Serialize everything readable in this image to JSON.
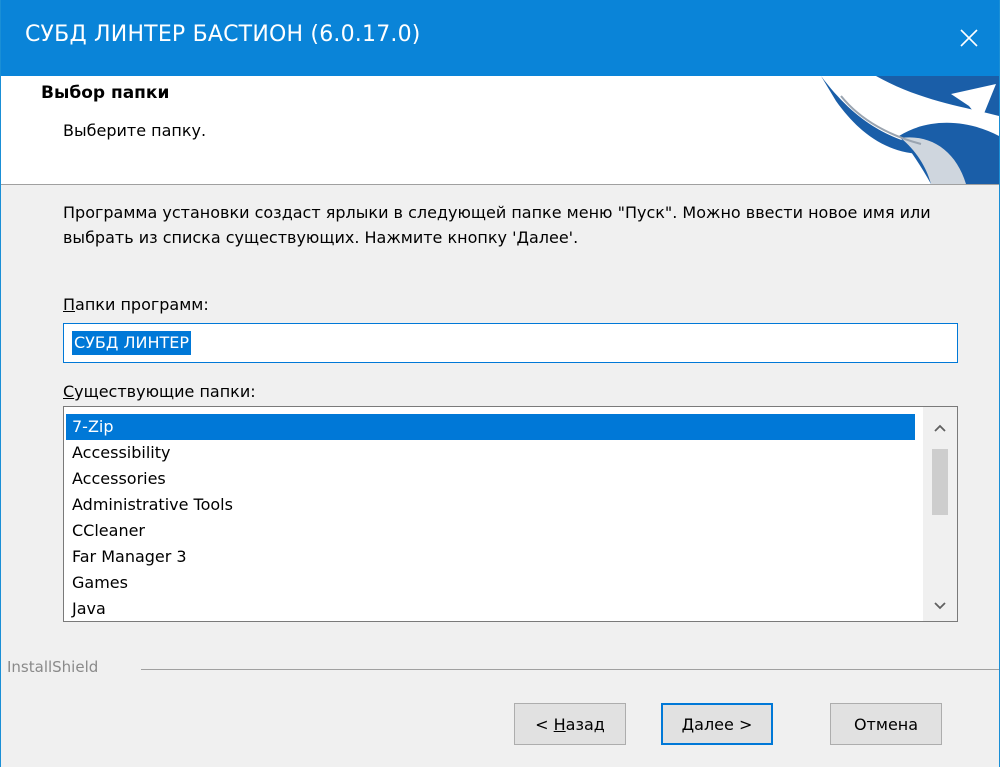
{
  "window": {
    "title": "СУБД ЛИНТЕР БАСТИОН (6.0.17.0)",
    "close_icon": "close-icon",
    "accent": "#0a84d8"
  },
  "header": {
    "title": "Выбор папки",
    "subtitle": "Выберите папку."
  },
  "description": "Программа установки создаст ярлыки в следующей папке меню \"Пуск\".  Можно ввести новое имя или выбрать из списка существующих. Нажмите кнопку 'Далее'.",
  "program_folder": {
    "label_hotkey": "П",
    "label_rest": "апки программ:",
    "value": "СУБД ЛИНТЕР"
  },
  "existing_folders": {
    "label_hotkey": "С",
    "label_rest": "уществующие папки:",
    "items": [
      "7-Zip",
      "Accessibility",
      "Accessories",
      "Administrative Tools",
      "CCleaner",
      "Far Manager 3",
      "Games",
      "Java"
    ],
    "selected_index": 0
  },
  "brand": "InstallShield",
  "buttons": {
    "back_prefix": "< ",
    "back_hotkey": "Н",
    "back_rest": "азад",
    "next_hotkey": "Д",
    "next_rest": "алее >",
    "cancel": "Отмена"
  }
}
